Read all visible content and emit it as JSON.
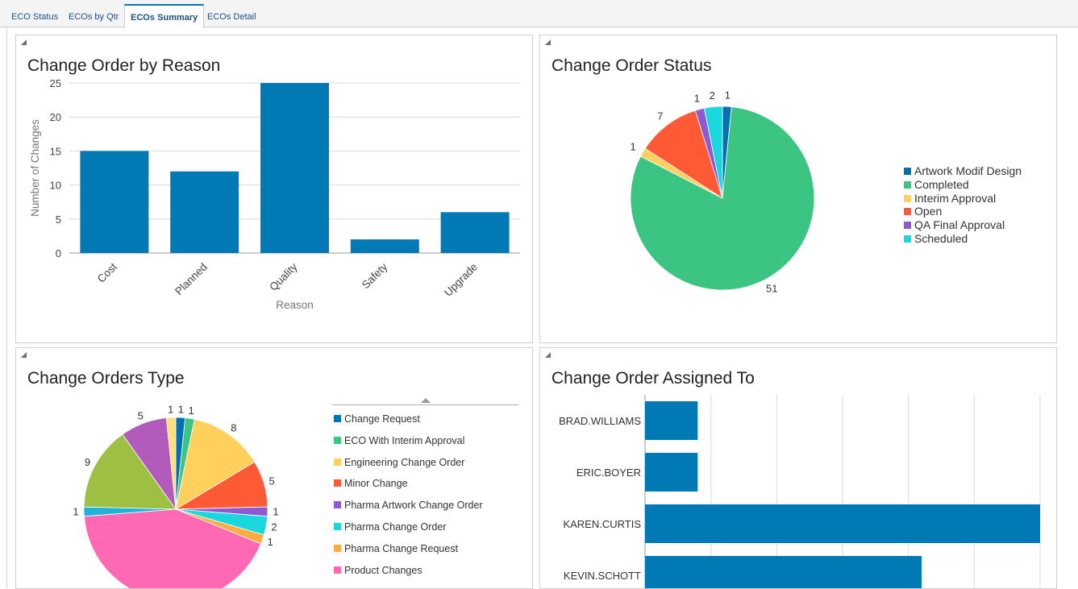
{
  "tabs": [
    {
      "label": "ECO Status",
      "active": false
    },
    {
      "label": "ECOs by Qtr",
      "active": false
    },
    {
      "label": "ECOs Summary",
      "active": true
    },
    {
      "label": "ECOs Detail",
      "active": false
    }
  ],
  "panels": {
    "reason": {
      "title": "Change Order by Reason"
    },
    "status": {
      "title": "Change Order Status"
    },
    "type": {
      "title": "Change Orders Type"
    },
    "assigned": {
      "title": "Change Order Assigned To"
    }
  },
  "chart_data": [
    {
      "type": "bar",
      "title": "Change Order by Reason",
      "xlabel": "Reason",
      "ylabel": "Number of Changes",
      "categories": [
        "Cost",
        "Planned",
        "Quality",
        "Safety",
        "Upgrade"
      ],
      "values": [
        15,
        12,
        25,
        2,
        6
      ],
      "ylim": [
        0,
        25
      ],
      "yticks": [
        0,
        5,
        10,
        15,
        20,
        25
      ],
      "grid": true,
      "color": "#0079b5"
    },
    {
      "type": "pie",
      "title": "Change Order Status",
      "legend_position": "right",
      "slices": [
        {
          "label": "Artwork Modif Design",
          "value": 1,
          "color": "#0072b2"
        },
        {
          "label": "Completed",
          "value": 51,
          "color": "#3cc483"
        },
        {
          "label": "Interim Approval",
          "value": 1,
          "color": "#ffd15c"
        },
        {
          "label": "Open",
          "value": 7,
          "color": "#ff5a36"
        },
        {
          "label": "QA Final Approval",
          "value": 1,
          "color": "#8e5ad4"
        },
        {
          "label": "Scheduled",
          "value": 2,
          "color": "#1ad7dd"
        }
      ]
    },
    {
      "type": "pie",
      "title": "Change Orders Type",
      "legend_position": "right",
      "slices": [
        {
          "label": "Change Request",
          "value": 1,
          "color": "#0072b2"
        },
        {
          "label": "ECO With Interim Approval",
          "value": 1,
          "color": "#3cc483"
        },
        {
          "label": "Engineering Change Order",
          "value": 8,
          "color": "#ffd15c"
        },
        {
          "label": "Minor Change",
          "value": 5,
          "color": "#ff5a36"
        },
        {
          "label": "Pharma Artwork Change Order",
          "value": 1,
          "color": "#8e5ad4"
        },
        {
          "label": "Pharma Change Order",
          "value": 2,
          "color": "#1ad7dd"
        },
        {
          "label": "Pharma Change Request",
          "value": 1,
          "color": "#ffad42"
        },
        {
          "label": "Product Changes",
          "value": 26,
          "color": "#ff69b4"
        },
        {
          "label": "",
          "value": 1,
          "color": "#20b2d8"
        },
        {
          "label": "",
          "value": 9,
          "color": "#9dc043"
        },
        {
          "label": "",
          "value": 5,
          "color": "#b35bbd"
        },
        {
          "label": "",
          "value": 1,
          "color": "#fde07a"
        }
      ]
    },
    {
      "type": "bar",
      "orientation": "horizontal",
      "title": "Change Order Assigned To",
      "categories": [
        "BRAD.WILLIAMS",
        "ERIC.BOYER",
        "KAREN.CURTIS",
        "KEVIN.SCHOTT"
      ],
      "values": [
        4,
        4,
        30,
        21
      ],
      "xlim": [
        0,
        30
      ],
      "grid": true,
      "color": "#0079b5"
    }
  ]
}
